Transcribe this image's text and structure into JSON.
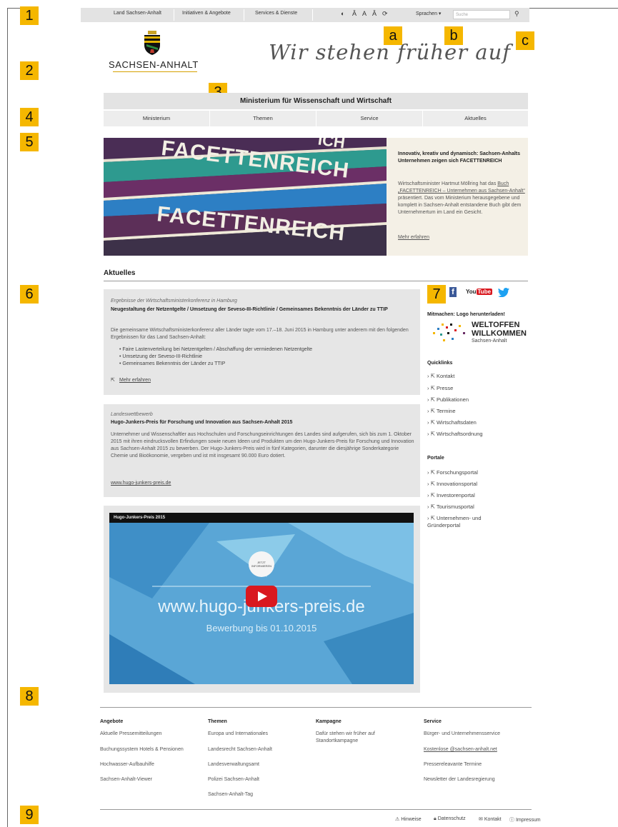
{
  "markers": {
    "m1": "1",
    "m2": "2",
    "m3": "3",
    "m4": "4",
    "m5": "5",
    "m6": "6",
    "m7": "7",
    "m8": "8",
    "m9": "9",
    "ma": "a",
    "mb": "b",
    "mc": "c"
  },
  "topbar": {
    "links": [
      "Land Sachsen-Anhalt",
      "Initiativen & Angebote",
      "Services & Dienste"
    ],
    "tools": {
      "contrast": "◐",
      "font_up": "Â",
      "font_normal": "A",
      "font_down": "Ǎ",
      "read": "⟳"
    },
    "languages": "Sprachen ▾",
    "search_placeholder": "Suche",
    "search_icon": "magnifier-icon"
  },
  "logo": {
    "text": "SACHSEN-ANHALT"
  },
  "slogan": "Wir stehen früher auf",
  "ministry_title": "Ministerium für Wissenschaft und Wirtschaft",
  "nav": [
    "Ministerium",
    "Themen",
    "Service",
    "Aktuelles"
  ],
  "hero": {
    "image_words": [
      "ICH",
      "FACETTENREICH",
      "FACETTENREICH"
    ],
    "title": "Innovativ, kreativ und dynamisch: Sachsen-Anhalts Unternehmen zeigen sich FACETTENREICH",
    "body_pre": "Wirtschaftsminister Hartmut Möllring hat das ",
    "body_link": "Buch „FACETTENREICH – Unternehmen aus Sachsen-Anhalt“",
    "body_post": " präsentiert. Das vom Ministerium herausgegebene und komplett in Sachsen-Anhalt entstandene Buch gibt dem Unternehmertum im Land ein Gesicht.",
    "more": "Mehr erfahren"
  },
  "aktuelles_heading": "Aktuelles",
  "news": [
    {
      "kicker": "Ergebnisse der Wirtschaftsministerkonferenz in Hamburg",
      "title": "Neugestaltung der Netzentgelte / Umsetzung der Seveso-III-Richtlinie / Gemeinsames Bekenntnis der Länder zu TTIP",
      "body": "Die gemeinsame Wirtschaftsministerkonferenz aller Länder tagte vom 17.–18. Juni 2015 in Hamburg unter anderem mit den folgenden Ergebnissen für das Land Sachsen-Anhalt:",
      "bullets": [
        "Faire Lastenverteilung bei Netzentgelten / Abschaffung der vermiedenen Netzentgelte",
        "Umsetzung der Seveso-III-Richtlinie",
        "Gemeinsames Bekenntnis der Länder zu TTIP"
      ],
      "link": "Mehr erfahren"
    },
    {
      "kicker": "Landeswettbewerb",
      "title": "Hugo-Junkers-Preis für Forschung und Innovation aus Sachsen-Anhalt 2015",
      "body": "Unternehmer und Wissenschaftler aus Hochschulen und Forschungseinrichtungen des Landes sind aufgerufen, sich bis zum 1. Oktober 2015 mit ihren eindrucksvollen Erfindungen sowie neuen Ideen und Produkten um den Hugo-Junkers-Preis für Forschung und Innovation aus Sachsen-Anhalt 2015 zu bewerben. Der Hugo-Junkers-Preis wird in fünf Kategorien, darunter die diesjährige Sonderkategorie Chemie und Bioökonomie, vergeben und ist mit insgesamt 90.000 Euro dotiert.",
      "link": "www.hugo-junkers-preis.de"
    }
  ],
  "video": {
    "title": "Hugo-Junkers-Preis 2015",
    "badge": "JETZT INFORMIEREN",
    "url": "www.hugo-junkers-preis.de",
    "subtitle": "Bewerbung bis 01.10.2015"
  },
  "sidebar": {
    "social": [
      "f",
      "YouTube",
      "twitter-bird"
    ],
    "logo_download": "Mitmachen: Logo herunterladen!",
    "willkommen": {
      "line1": "WELTOFFEN",
      "line2": "WILLKOMMEN",
      "line3": "Sachsen-Anhalt"
    },
    "quicklinks_heading": "Quicklinks",
    "quicklinks": [
      "Kontakt",
      "Presse",
      "Publikationen",
      "Termine",
      "Wirtschaftsdaten",
      "Wirtschaftsordnung"
    ],
    "portale_heading": "Portale",
    "portale": [
      "Forschungsportal",
      "Innovationsportal",
      "Investorenportal",
      "Tourismusportal",
      "Unternehmen- und Gründerportal"
    ]
  },
  "footer": {
    "columns": [
      {
        "heading": "Angebote",
        "links": [
          "Aktuelle Pressemitteilungen",
          "Buchungssystem Hotels & Pensionen",
          "Hochwasser-Aufbauhilfe",
          "Sachsen-Anhalt-Viewer"
        ]
      },
      {
        "heading": "Themen",
        "links": [
          "Europa und Internationales",
          "Landesrecht Sachsen-Anhalt",
          "Landesverwaltungsamt",
          "Polizei Sachsen-Anhalt",
          "Sachsen-Anhalt-Tag"
        ]
      },
      {
        "heading": "Kampagne",
        "links": [
          "Dafür stehen wir früher auf",
          "Standortkampagne"
        ]
      },
      {
        "heading": "Service",
        "links": [
          "Bürger- und Unternehmensservice",
          "Kostenlose @sachsen-anhalt.net",
          "Pressereleavante Termine",
          "Newsletter der Landesregierung"
        ]
      }
    ],
    "bottom": [
      "Hinweise",
      "Datenschutz",
      "Kontakt",
      "Impressum"
    ]
  },
  "colors": {
    "marker": "#f5b700",
    "bar": "#e3e3e3",
    "youtube": "#d9181f",
    "facebook": "#3b5998",
    "twitter": "#1da1f2"
  }
}
